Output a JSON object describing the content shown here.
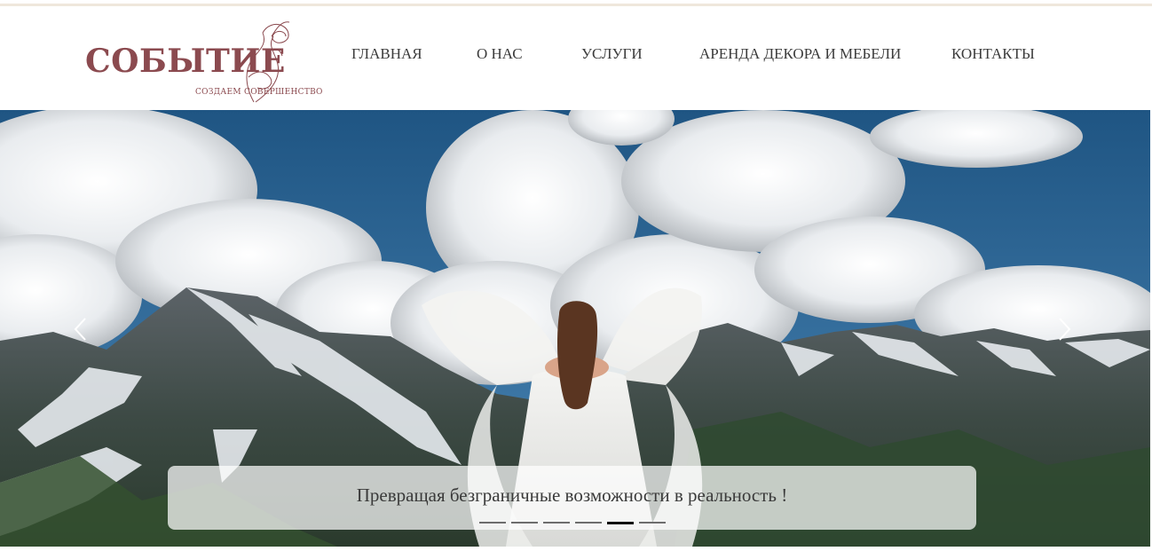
{
  "brand": {
    "name": "СОБЫТИЕ",
    "tagline": "СОЗДАЕМ СОВЕРШЕНСТВО",
    "color": "#8b4a4f"
  },
  "nav": {
    "items": [
      {
        "label": "ГЛАВНАЯ"
      },
      {
        "label": "О НАС"
      },
      {
        "label": "УСЛУГИ"
      },
      {
        "label": "АРЕНДА ДЕКОРА И МЕБЕЛИ"
      },
      {
        "label": "КОНТАКТЫ"
      }
    ]
  },
  "slider": {
    "caption": "Превращая безграничные возможности в реальность !",
    "slide_count": 6,
    "active_slide": 5,
    "prev_icon": "chevron-left-icon",
    "next_icon": "chevron-right-icon"
  }
}
